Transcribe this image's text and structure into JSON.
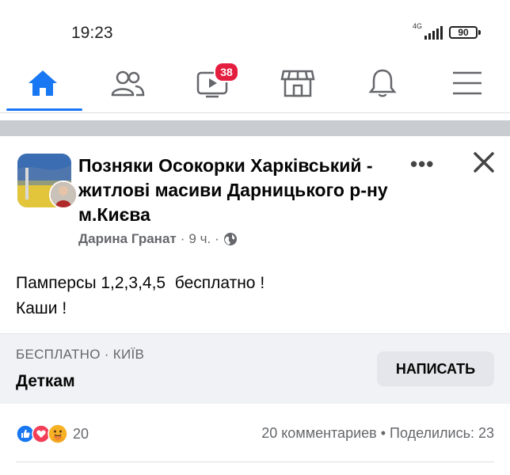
{
  "status_bar": {
    "time": "19:23",
    "network": "4G",
    "battery": "90"
  },
  "nav": {
    "items": [
      {
        "name": "home",
        "active": true
      },
      {
        "name": "friends"
      },
      {
        "name": "watch",
        "badge": "38"
      },
      {
        "name": "marketplace"
      },
      {
        "name": "notifications"
      },
      {
        "name": "menu"
      }
    ],
    "accent": "#1877f2",
    "badge_color": "#e41e3f"
  },
  "post": {
    "group_name": "Позняки Осокорки Харківський - житлові масиви Дарницького р-ну м.Києва",
    "author": "Дарина Гранат",
    "time": "9 ч.",
    "text_lines": [
      "Памперсы 1,2,3,4,5  бесплатно !",
      "Каши !"
    ]
  },
  "listing": {
    "category": "БЕСПЛАТНО · КИЇВ",
    "title": "Деткам",
    "button": "НАПИСАТЬ"
  },
  "engagement": {
    "reactions_count": "20",
    "stats": "20 комментариев • Поделились: 23"
  }
}
